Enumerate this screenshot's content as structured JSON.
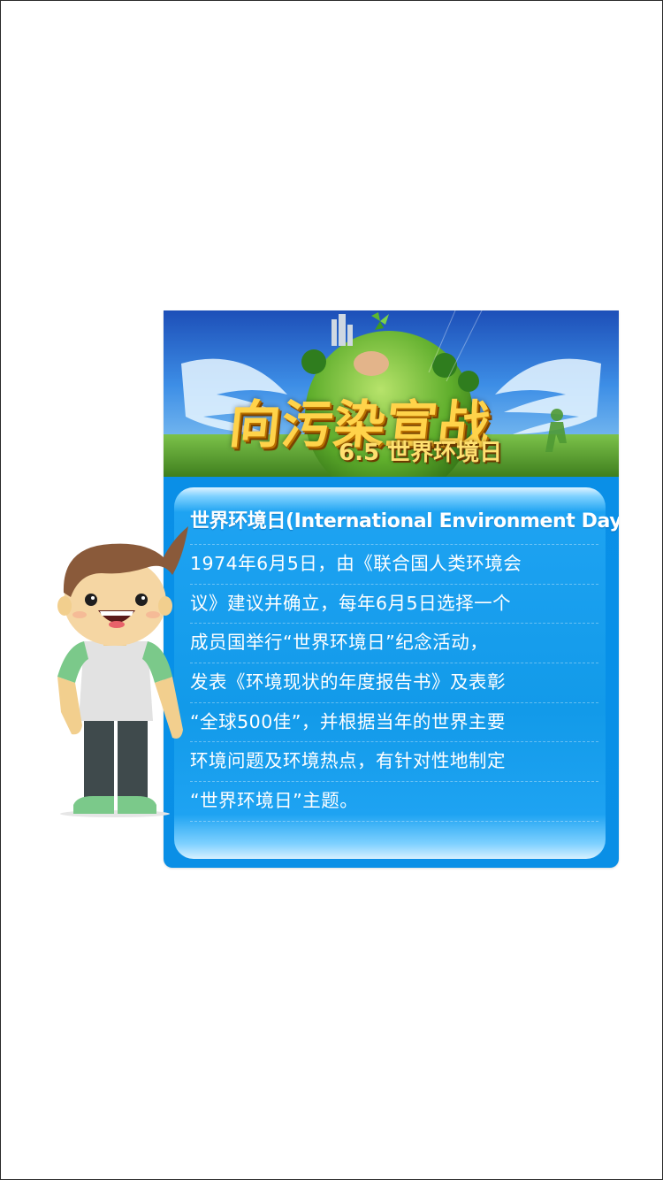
{
  "banner": {
    "title": "向污染宣战",
    "subtitle": "6.5 世界环境日"
  },
  "article": {
    "heading": "世界环境日(International Environment Day)",
    "lines": [
      "1974年6月5日，由《联合国人类环境会",
      "议》建议并确立，每年6月5日选择一个",
      "成员国举行“世界环境日”纪念活动，",
      "发表《环境现状的年度报告书》及表彰",
      "“全球500佳”，并根据当年的世界主要",
      "环境问题及环境热点，有针对性地制定",
      "“世界环境日”主题。"
    ]
  },
  "colors": {
    "card_blue": "#0790e8",
    "title_yellow": "#ffd34a",
    "shirt_green": "#7bc98a",
    "hair_brown": "#8a5a3a"
  }
}
